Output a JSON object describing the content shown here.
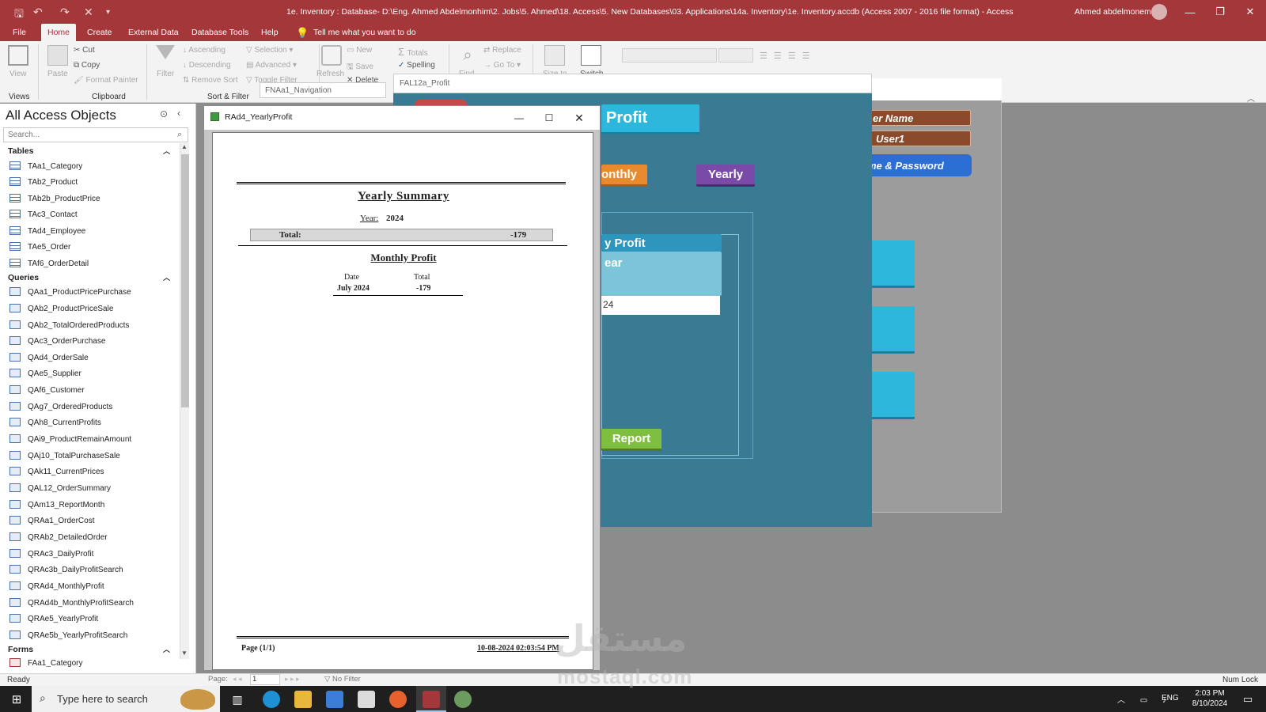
{
  "window": {
    "title": "1e. Inventory : Database- D:\\Eng. Ahmed Abdelmonhim\\2. Jobs\\5. Ahmed\\18. Access\\5. New Databases\\03. Applications\\14a. Inventory\\1e. Inventory.accdb (Access 2007 - 2016 file format) - Access",
    "user": "Ahmed abdelmonem"
  },
  "ribbon_tabs": [
    "File",
    "Home",
    "Create",
    "External Data",
    "Database Tools",
    "Help"
  ],
  "tell_me": "Tell me what you want to do",
  "ribbon": {
    "view": "View",
    "paste": "Paste",
    "cut": "Cut",
    "copy": "Copy",
    "format_painter": "Format Painter",
    "filter": "Filter",
    "ascending": "Ascending",
    "descending": "Descending",
    "remove_sort": "Remove Sort",
    "selection": "Selection",
    "advanced": "Advanced",
    "toggle_filter": "Toggle Filter",
    "refresh": "Refresh",
    "new": "New",
    "save": "Save",
    "delete": "Delete",
    "totals": "Totals",
    "spelling": "Spelling",
    "find": "Find",
    "replace": "Replace",
    "go_to": "Go To",
    "size_to": "Size to",
    "switch": "Switch",
    "group_views": "Views",
    "group_clipboard": "Clipboard",
    "group_sort": "Sort & Filter"
  },
  "nav": {
    "title": "All Access Objects",
    "search_placeholder": "Search...",
    "categories": {
      "tables": "Tables",
      "queries": "Queries",
      "forms": "Forms"
    },
    "tables": [
      "TAa1_Category",
      "TAb2_Product",
      "TAb2b_ProductPrice",
      "TAc3_Contact",
      "TAd4_Employee",
      "TAe5_Order",
      "TAf6_OrderDetail"
    ],
    "queries": [
      "QAa1_ProductPricePurchase",
      "QAb2_ProductPriceSale",
      "QAb2_TotalOrderedProducts",
      "QAc3_OrderPurchase",
      "QAd4_OrderSale",
      "QAe5_Supplier",
      "QAf6_Customer",
      "QAg7_OrderedProducts",
      "QAh8_CurrentProfits",
      "QAi9_ProductRemainAmount",
      "QAj10_TotalPurchaseSale",
      "QAk11_CurrentPrices",
      "QAL12_OrderSummary",
      "QAm13_ReportMonth",
      "QRAa1_OrderCost",
      "QRAb2_DetailedOrder",
      "QRAc3_DailyProfit",
      "QRAc3b_DailyProfitSearch",
      "QRAd4_MonthlyProfit",
      "QRAd4b_MonthlyProfitSearch",
      "QRAe5_YearlyProfit",
      "QRAe5b_YearlyProfitSearch"
    ],
    "forms": [
      "FAa1_Category"
    ]
  },
  "bg_forms": {
    "navigation_tab": "FNAa1_Navigation",
    "profit_form_tab": "FAL12a_Profit",
    "profit_header": "Profit",
    "monthly_btn": "onthly",
    "yearly_btn": "Yearly",
    "list_header": "y Profit",
    "list_sub": "ear",
    "list_value": "24",
    "report_btn": "Report",
    "user_name_label": "er Name",
    "user_value": "User1",
    "name_password_btn": "me & Password"
  },
  "report": {
    "window_title": "RAd4_YearlyProfit",
    "heading": "Yearly Summary",
    "year_label": "Year:",
    "year_value": "2024",
    "total_label": "Total:",
    "total_value": "-179",
    "monthly_heading": "Monthly Profit",
    "col_date": "Date",
    "col_total": "Total",
    "rows": [
      {
        "date": "July 2024",
        "total": "-179"
      }
    ],
    "page_text": "Page (1/1)",
    "printed_at": "10-08-2024 02:03:54 PM"
  },
  "status": {
    "ready": "Ready",
    "num_lock": "Num Lock",
    "page_label": "Page:",
    "page_value": "1",
    "no_filter": "No Filter"
  },
  "taskbar": {
    "search_placeholder": "Type here to search",
    "language": "ENG",
    "time": "2:03 PM",
    "date": "8/10/2024"
  },
  "watermark": {
    "arabic": "مستقل",
    "latin": "mostaql.com"
  },
  "colors": {
    "access_red": "#a4373a",
    "form_teal": "#3a7a92",
    "button_cyan": "#2db7dc",
    "yearly_purple": "#7a4aa8",
    "monthly_orange": "#e98a2e",
    "report_green": "#7fbf3f",
    "label_brown": "#8b4a2b"
  }
}
